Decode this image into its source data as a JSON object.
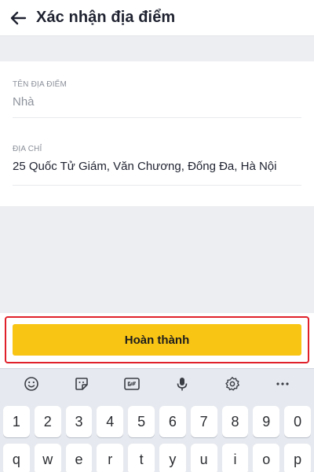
{
  "header": {
    "title": "Xác nhận địa điểm",
    "back_icon": "arrow-left-icon"
  },
  "form": {
    "place_name": {
      "label": "TÊN ĐỊA ĐIỂM",
      "value": "Nhà"
    },
    "address": {
      "label": "ĐỊA CHỈ",
      "value": "25 Quốc Tử Giám, Văn Chương, Đống Đa, Hà Nội"
    }
  },
  "action": {
    "done_label": "Hoàn thành",
    "button_color": "#f8c514",
    "highlight_color": "#e0202a"
  },
  "keyboard": {
    "toolbar_icons": [
      "emoji-icon",
      "sticker-icon",
      "gif-icon",
      "microphone-icon",
      "settings-icon",
      "more-icon"
    ],
    "number_row": [
      "1",
      "2",
      "3",
      "4",
      "5",
      "6",
      "7",
      "8",
      "9",
      "0"
    ],
    "letter_row": [
      "q",
      "w",
      "e",
      "r",
      "t",
      "y",
      "u",
      "i",
      "o",
      "p"
    ]
  }
}
